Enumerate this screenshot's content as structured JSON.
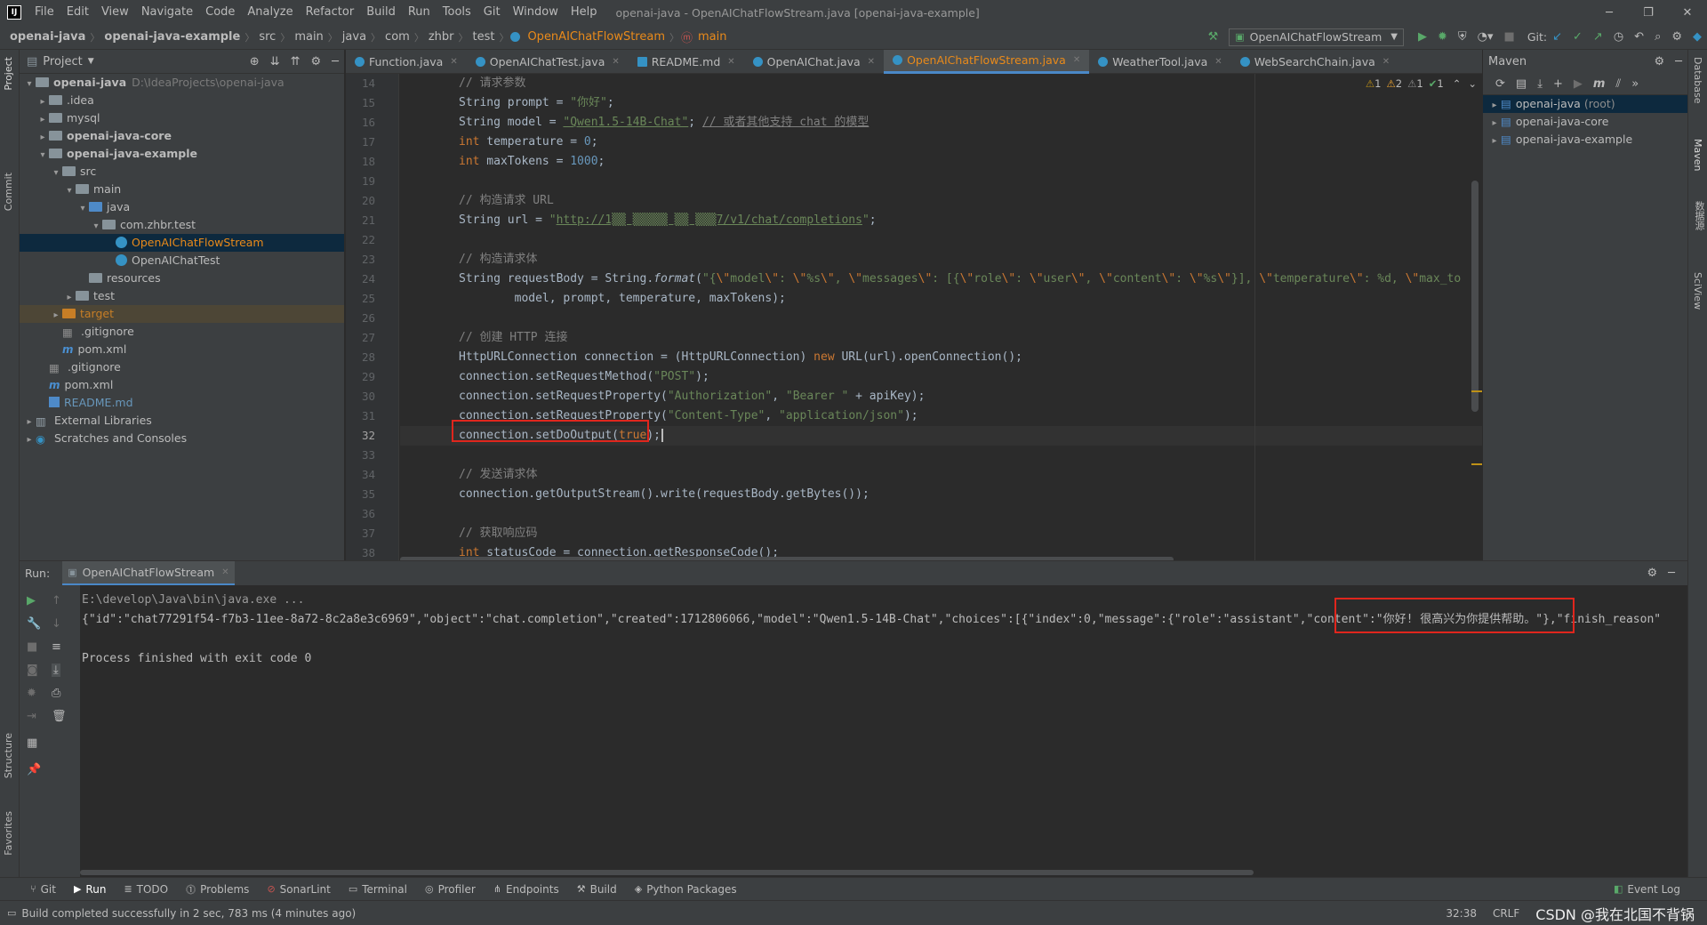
{
  "titlebar": {
    "menu": [
      "File",
      "Edit",
      "View",
      "Navigate",
      "Code",
      "Analyze",
      "Refactor",
      "Build",
      "Run",
      "Tools",
      "Git",
      "Window",
      "Help"
    ],
    "title": "openai-java - OpenAIChatFlowStream.java [openai-java-example]"
  },
  "breadcrumb": [
    "openai-java",
    "openai-java-example",
    "src",
    "main",
    "java",
    "com",
    "zhbr",
    "test",
    "OpenAIChatFlowStream",
    "main"
  ],
  "toolbar": {
    "run_config": "OpenAIChatFlowStream",
    "git_label": "Git:"
  },
  "project_panel": {
    "title": "Project",
    "items": [
      {
        "depth": 0,
        "arrow": "▾",
        "icon": "folder",
        "label": "openai-java",
        "extra": "D:\\IdeaProjects\\openai-java",
        "bold": true
      },
      {
        "depth": 1,
        "arrow": "▸",
        "icon": "folder",
        "label": ".idea"
      },
      {
        "depth": 1,
        "arrow": "▸",
        "icon": "folder",
        "label": "mysql"
      },
      {
        "depth": 1,
        "arrow": "▸",
        "icon": "folder",
        "label": "openai-java-core",
        "bold": true
      },
      {
        "depth": 1,
        "arrow": "▾",
        "icon": "folder",
        "label": "openai-java-example",
        "bold": true
      },
      {
        "depth": 2,
        "arrow": "▾",
        "icon": "folder",
        "label": "src"
      },
      {
        "depth": 3,
        "arrow": "▾",
        "icon": "folder",
        "label": "main"
      },
      {
        "depth": 4,
        "arrow": "▾",
        "icon": "folder-blue",
        "label": "java"
      },
      {
        "depth": 5,
        "arrow": "▾",
        "icon": "folder",
        "label": "com.zhbr.test"
      },
      {
        "depth": 6,
        "arrow": "",
        "icon": "class",
        "label": "OpenAIChatFlowStream",
        "selected": true
      },
      {
        "depth": 6,
        "arrow": "",
        "icon": "class",
        "label": "OpenAIChatTest"
      },
      {
        "depth": 4,
        "arrow": "",
        "icon": "folder",
        "label": "resources"
      },
      {
        "depth": 3,
        "arrow": "▸",
        "icon": "folder",
        "label": "test"
      },
      {
        "depth": 2,
        "arrow": "▸",
        "icon": "folder-orange",
        "label": "target",
        "target": true
      },
      {
        "depth": 2,
        "arrow": "",
        "icon": "file",
        "label": ".gitignore"
      },
      {
        "depth": 2,
        "arrow": "",
        "icon": "maven",
        "label": "pom.xml"
      },
      {
        "depth": 1,
        "arrow": "",
        "icon": "file",
        "label": ".gitignore"
      },
      {
        "depth": 1,
        "arrow": "",
        "icon": "maven",
        "label": "pom.xml"
      },
      {
        "depth": 1,
        "arrow": "",
        "icon": "md",
        "label": "README.md",
        "blue": true
      },
      {
        "depth": 0,
        "arrow": "▸",
        "icon": "lib",
        "label": "External Libraries"
      },
      {
        "depth": 0,
        "arrow": "▸",
        "icon": "scratch",
        "label": "Scratches and Consoles"
      }
    ]
  },
  "editor_tabs": [
    {
      "label": "Function.java",
      "active": false
    },
    {
      "label": "OpenAIChatTest.java",
      "active": false
    },
    {
      "label": "README.md",
      "active": false
    },
    {
      "label": "OpenAIChat.java",
      "active": false
    },
    {
      "label": "OpenAIChatFlowStream.java",
      "active": true
    },
    {
      "label": "WeatherTool.java",
      "active": false
    },
    {
      "label": "WebSearchChain.java",
      "active": false
    }
  ],
  "inspections": {
    "warn1": "1",
    "warn2": "2",
    "weak": "1",
    "ok": "1"
  },
  "code": {
    "lines": [
      {
        "n": "14",
        "html": "<span class=\"cm\">// 请求参数</span>"
      },
      {
        "n": "15",
        "html": "String prompt = <span class=\"st\">\"你好\"</span>;"
      },
      {
        "n": "16",
        "html": "String model = <span class=\"st ul\">\"Qwen1.5-14B-Chat\"</span>; <span class=\"cm ul\">// 或者其他支持 chat 的模型</span>"
      },
      {
        "n": "17",
        "html": "<span class=\"kw\">int</span> temperature = <span class=\"nu\">0</span>;"
      },
      {
        "n": "18",
        "html": "<span class=\"kw\">int</span> maxTokens = <span class=\"nu\">1000</span>;"
      },
      {
        "n": "19",
        "html": ""
      },
      {
        "n": "20",
        "html": "<span class=\"cm\">// 构造请求 URL</span>"
      },
      {
        "n": "21",
        "html": "String url = <span class=\"st\">\"<span class=\"ul\">http://1▒▒ ▒▒▒▒▒ ▒▒ ▒▒▒7/v1/chat/completions</span>\"</span>;"
      },
      {
        "n": "22",
        "html": ""
      },
      {
        "n": "23",
        "html": "<span class=\"cm\">// 构造请求体</span>"
      },
      {
        "n": "24",
        "html": "String requestBody = String.<span class=\"it\">format</span>(<span class=\"st\">\"{<span class=\"kw\">\\\"</span>model<span class=\"kw\">\\\"</span>: <span class=\"kw\">\\\"</span>%s<span class=\"kw\">\\\"</span>, <span class=\"kw\">\\\"</span>messages<span class=\"kw\">\\\"</span>: [{<span class=\"kw\">\\\"</span>role<span class=\"kw\">\\\"</span>: <span class=\"kw\">\\\"</span>user<span class=\"kw\">\\\"</span>, <span class=\"kw\">\\\"</span>content<span class=\"kw\">\\\"</span>: <span class=\"kw\">\\\"</span>%s<span class=\"kw\">\\\"</span>}], <span class=\"kw\">\\\"</span>temperature<span class=\"kw\">\\\"</span>: %d, <span class=\"kw\">\\\"</span>max_to</span>"
      },
      {
        "n": "25",
        "html": "        model, prompt, temperature, maxTokens);"
      },
      {
        "n": "26",
        "html": ""
      },
      {
        "n": "27",
        "html": "<span class=\"cm\">// 创建 HTTP 连接</span>"
      },
      {
        "n": "28",
        "html": "HttpURLConnection connection = (HttpURLConnection) <span class=\"kw\">new</span> URL(url).openConnection();"
      },
      {
        "n": "29",
        "html": "connection.setRequestMethod(<span class=\"st\">\"POST\"</span>);"
      },
      {
        "n": "30",
        "html": "connection.setRequestProperty(<span class=\"st\">\"Authorization\"</span>, <span class=\"st\">\"Bearer \"</span> + apiKey);"
      },
      {
        "n": "31",
        "html": "connection.setRequestProperty(<span class=\"st\">\"Content-Type\"</span>, <span class=\"st\">\"application/json\"</span>);"
      },
      {
        "n": "32",
        "html": "connection.setDoOutput(<span class=\"kw\">true</span>);",
        "current": true
      },
      {
        "n": "33",
        "html": ""
      },
      {
        "n": "34",
        "html": "<span class=\"cm\">// 发送请求体</span>"
      },
      {
        "n": "35",
        "html": "connection.getOutputStream().write(requestBody.getBytes());"
      },
      {
        "n": "36",
        "html": ""
      },
      {
        "n": "37",
        "html": "<span class=\"cm\">// 获取响应码</span>"
      },
      {
        "n": "38",
        "html": "<span class=\"kw\">int</span> statusCode = connection.getResponseCode();"
      }
    ]
  },
  "maven_panel": {
    "title": "Maven",
    "items": [
      {
        "label": "openai-java",
        "suffix": "(root)",
        "selected": true
      },
      {
        "label": "openai-java-core"
      },
      {
        "label": "openai-java-example"
      }
    ]
  },
  "run_panel": {
    "label": "Run:",
    "tab": "OpenAIChatFlowStream",
    "console": {
      "cmd": "E:\\develop\\Java\\bin\\java.exe ...",
      "output": "{\"id\":\"chat77291f54-f7b3-11ee-8a72-8c2a8e3c6969\",\"object\":\"chat.completion\",\"created\":1712806066,\"model\":\"Qwen1.5-14B-Chat\",\"choices\":[{\"index\":0,\"message\":{\"role\":\"assistant\",\"content\":\"你好! 很高兴为你提供帮助。\"},\"finish_reason\"",
      "exit": "Process finished with exit code 0"
    }
  },
  "bottom_tabs": [
    "Git",
    "Run",
    "TODO",
    "Problems",
    "SonarLint",
    "Terminal",
    "Profiler",
    "Endpoints",
    "Build",
    "Python Packages"
  ],
  "event_log": "Event Log",
  "status": {
    "message": "Build completed successfully in 2 sec, 783 ms (4 minutes ago)",
    "position": "32:38",
    "line_sep": "CRLF",
    "watermark": "CSDN @我在北国不背锅"
  },
  "side_tabs": {
    "left": [
      "Project",
      "Commit",
      "Structure",
      "Favorites"
    ],
    "right": [
      "Database",
      "Maven",
      "数据源",
      "SciView"
    ]
  }
}
